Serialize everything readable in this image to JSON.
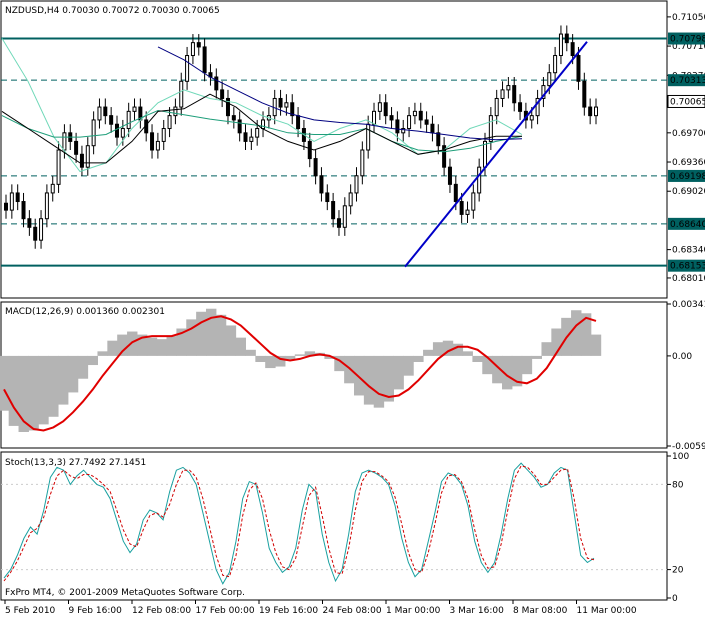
{
  "colors": {
    "background": "#ffffff",
    "frame": "#000000",
    "grid": "#000000",
    "candle_up": "#000000",
    "candle_down": "#000000",
    "ma_fast": "#000000",
    "ma_mid": "#1e9e7a",
    "ma_slow": "#6fd8b8",
    "ma_long": "#000080",
    "trendline": "#0000c8",
    "hline": "#006060",
    "hline_dash": "#006060",
    "macd_hist": "#b4b4b4",
    "macd_signal": "#e00000",
    "stoch_main": "#19a0a0",
    "stoch_signal": "#d00000",
    "label_box_fill": "#006060",
    "label_box_text": "#ffffff",
    "label_box_fill_white": "#ffffff"
  },
  "chart_data": [
    {
      "type": "candlestick",
      "title": "NZDUSD,H4  0.70030 0.70072 0.70030 0.70065",
      "ylim": [
        0.678,
        0.712
      ],
      "y_ticks": [
        "0.71050",
        "0.70710",
        "0.70370",
        "0.69700",
        "0.69360",
        "0.69020",
        "0.68340",
        "0.68010"
      ],
      "y_tick_values": [
        0.7105,
        0.7071,
        0.7037,
        0.697,
        0.6936,
        0.6902,
        0.6834,
        0.6801
      ],
      "current_price_label": "0.70065",
      "current_price": 0.70065,
      "horizontal_lines": [
        {
          "label": "0.70798",
          "value": 0.70798,
          "style": "solid"
        },
        {
          "label": "0.70313",
          "value": 0.70313,
          "style": "dashed"
        },
        {
          "label": "0.69198",
          "value": 0.69198,
          "style": "dashed"
        },
        {
          "label": "0.68640",
          "value": 0.6864,
          "style": "dashed"
        },
        {
          "label": "0.68153",
          "value": 0.68153,
          "style": "solid"
        }
      ],
      "trendline": {
        "from": {
          "bar": 155,
          "price": 0.6814
        },
        "to": {
          "bar": 225,
          "price": 0.7076
        }
      },
      "series": [
        {
          "kind": "ma",
          "points": [
            [
              0,
              0.708
            ],
            [
              10,
              0.703
            ],
            [
              20,
              0.6965
            ],
            [
              30,
              0.6925
            ],
            [
              40,
              0.6935
            ],
            [
              50,
              0.6975
            ],
            [
              60,
              0.7005
            ],
            [
              70,
              0.702
            ],
            [
              80,
              0.701
            ],
            [
              90,
              0.7005
            ],
            [
              100,
              0.699
            ],
            [
              110,
              0.698
            ],
            [
              120,
              0.696
            ],
            [
              130,
              0.6975
            ],
            [
              140,
              0.6985
            ],
            [
              150,
              0.697
            ],
            [
              160,
              0.6945
            ],
            [
              170,
              0.695
            ],
            [
              180,
              0.6975
            ],
            [
              190,
              0.6985
            ],
            [
              200,
              0.6968
            ]
          ],
          "color_key": "ma_slow"
        },
        {
          "kind": "ma",
          "points": [
            [
              0,
              0.699
            ],
            [
              10,
              0.6975
            ],
            [
              20,
              0.6965
            ],
            [
              30,
              0.6965
            ],
            [
              40,
              0.6968
            ],
            [
              50,
              0.6983
            ],
            [
              60,
              0.6996
            ],
            [
              70,
              0.6991
            ],
            [
              80,
              0.6986
            ],
            [
              90,
              0.6982
            ],
            [
              100,
              0.6978
            ],
            [
              110,
              0.697
            ],
            [
              120,
              0.6968
            ],
            [
              130,
              0.6968
            ],
            [
              140,
              0.6975
            ],
            [
              150,
              0.696
            ],
            [
              160,
              0.695
            ],
            [
              170,
              0.6948
            ],
            [
              180,
              0.6952
            ],
            [
              190,
              0.696
            ],
            [
              200,
              0.6966
            ]
          ],
          "color_key": "ma_mid"
        },
        {
          "kind": "ma",
          "points": [
            [
              0,
              0.6995
            ],
            [
              10,
              0.6975
            ],
            [
              20,
              0.6955
            ],
            [
              30,
              0.6935
            ],
            [
              40,
              0.6935
            ],
            [
              50,
              0.696
            ],
            [
              60,
              0.6995
            ],
            [
              70,
              0.6998
            ],
            [
              80,
              0.7015
            ],
            [
              90,
              0.7
            ],
            [
              100,
              0.6975
            ],
            [
              110,
              0.696
            ],
            [
              120,
              0.695
            ],
            [
              130,
              0.696
            ],
            [
              140,
              0.6975
            ],
            [
              150,
              0.696
            ],
            [
              160,
              0.6945
            ],
            [
              170,
              0.695
            ],
            [
              180,
              0.696
            ],
            [
              190,
              0.6966
            ],
            [
              200,
              0.6966
            ]
          ],
          "color_key": "ma_fast"
        },
        {
          "kind": "ma",
          "points": [
            [
              60,
              0.707
            ],
            [
              70,
              0.7055
            ],
            [
              80,
              0.7035
            ],
            [
              90,
              0.702
            ],
            [
              100,
              0.7005
            ],
            [
              110,
              0.6993
            ],
            [
              120,
              0.6985
            ],
            [
              130,
              0.6982
            ],
            [
              140,
              0.698
            ],
            [
              150,
              0.6975
            ],
            [
              160,
              0.6972
            ],
            [
              170,
              0.6968
            ],
            [
              180,
              0.6964
            ],
            [
              190,
              0.6962
            ],
            [
              200,
              0.6963
            ]
          ],
          "color_key": "ma_long"
        }
      ],
      "candles_note": "",
      "ohlc_closes": [
        0.688,
        0.69,
        0.689,
        0.687,
        0.686,
        0.6845,
        0.687,
        0.69,
        0.691,
        0.695,
        0.697,
        0.696,
        0.6945,
        0.693,
        0.6955,
        0.6985,
        0.7,
        0.699,
        0.698,
        0.6965,
        0.6975,
        0.6995,
        0.7,
        0.6985,
        0.697,
        0.695,
        0.696,
        0.6975,
        0.699,
        0.7,
        0.703,
        0.706,
        0.7075,
        0.707,
        0.704,
        0.7035,
        0.702,
        0.701,
        0.699,
        0.6985,
        0.697,
        0.696,
        0.6965,
        0.6975,
        0.6985,
        0.699,
        0.701,
        0.7,
        0.7005,
        0.699,
        0.6975,
        0.696,
        0.694,
        0.692,
        0.69,
        0.689,
        0.687,
        0.686,
        0.6885,
        0.69,
        0.692,
        0.695,
        0.698,
        0.6995,
        0.7005,
        0.699,
        0.6985,
        0.697,
        0.6975,
        0.699,
        0.6995,
        0.6985,
        0.698,
        0.697,
        0.6955,
        0.693,
        0.691,
        0.689,
        0.6875,
        0.688,
        0.69,
        0.693,
        0.696,
        0.699,
        0.701,
        0.702,
        0.7025,
        0.7005,
        0.6995,
        0.6985,
        0.699,
        0.701,
        0.7025,
        0.704,
        0.706,
        0.7085,
        0.7075,
        0.706,
        0.703,
        0.7,
        0.699,
        0.7
      ]
    },
    {
      "type": "histogram+line",
      "title": "MACD(12,26,9) 0.001360 0.002301",
      "ylim": [
        -0.00592,
        0.00341
      ],
      "y_ticks": [
        "0.00341",
        "0.00",
        "-0.00592"
      ],
      "y_tick_values": [
        0.00341,
        0.0,
        -0.00592
      ],
      "histogram": [
        -0.0036,
        -0.0046,
        -0.005,
        -0.0049,
        -0.0045,
        -0.004,
        -0.0032,
        -0.0024,
        -0.0015,
        -0.0006,
        0.0003,
        0.001,
        0.0014,
        0.0016,
        0.0014,
        0.0012,
        0.0011,
        0.0013,
        0.0018,
        0.0024,
        0.0029,
        0.0031,
        0.0027,
        0.002,
        0.0012,
        0.0004,
        -0.0004,
        -0.0008,
        -0.0007,
        -0.0003,
        0.0001,
        0.0003,
        0.0002,
        -0.0002,
        -0.001,
        -0.0018,
        -0.0026,
        -0.0032,
        -0.0034,
        -0.003,
        -0.0022,
        -0.0013,
        -0.0004,
        0.0004,
        0.0009,
        0.001,
        0.0008,
        0.0003,
        -0.0004,
        -0.0012,
        -0.0018,
        -0.0022,
        -0.002,
        -0.0012,
        -0.0002,
        0.0009,
        0.0018,
        0.0025,
        0.003,
        0.0028,
        0.0014
      ],
      "signal": [
        -0.0022,
        -0.0034,
        -0.0043,
        -0.0048,
        -0.0049,
        -0.0047,
        -0.0043,
        -0.0037,
        -0.003,
        -0.0022,
        -0.0013,
        -0.0005,
        0.0003,
        0.0009,
        0.0012,
        0.0013,
        0.0013,
        0.0013,
        0.0015,
        0.0018,
        0.0022,
        0.0025,
        0.0026,
        0.0024,
        0.002,
        0.0014,
        0.0008,
        0.0002,
        -0.0002,
        -0.0003,
        -0.0002,
        0.0,
        0.0001,
        0.0,
        -0.0003,
        -0.0008,
        -0.0014,
        -0.002,
        -0.0025,
        -0.0027,
        -0.0026,
        -0.0022,
        -0.0016,
        -0.0009,
        -0.0002,
        0.0003,
        0.0006,
        0.0006,
        0.0004,
        -0.0001,
        -0.0007,
        -0.0013,
        -0.0017,
        -0.0018,
        -0.0015,
        -0.0008,
        0.0002,
        0.0012,
        0.002,
        0.0025,
        0.0023
      ]
    },
    {
      "type": "line",
      "title": "Stoch(13,3,3) 27.7492 27.1451",
      "ylim": [
        0,
        100
      ],
      "y_ticks": [
        "100",
        "80",
        "20",
        "0"
      ],
      "y_tick_values": [
        100,
        80,
        20,
        0
      ],
      "series": [
        {
          "color_key": "stoch_main",
          "values": [
            14,
            20,
            30,
            42,
            50,
            45,
            62,
            85,
            92,
            90,
            80,
            86,
            90,
            85,
            80,
            78,
            70,
            55,
            40,
            32,
            38,
            55,
            62,
            60,
            55,
            75,
            90,
            92,
            88,
            80,
            60,
            40,
            20,
            10,
            18,
            40,
            70,
            82,
            80,
            60,
            35,
            25,
            18,
            22,
            35,
            62,
            80,
            75,
            45,
            25,
            12,
            20,
            45,
            75,
            88,
            90,
            88,
            85,
            80,
            65,
            42,
            25,
            15,
            20,
            40,
            60,
            82,
            88,
            86,
            80,
            65,
            40,
            25,
            18,
            25,
            45,
            70,
            90,
            95,
            90,
            85,
            78,
            80,
            88,
            92,
            90,
            60,
            30,
            25,
            28
          ]
        },
        {
          "color_key": "stoch_signal",
          "values": [
            12,
            18,
            26,
            36,
            46,
            49,
            57,
            73,
            86,
            90,
            86,
            84,
            87,
            87,
            84,
            80,
            75,
            62,
            48,
            38,
            36,
            48,
            58,
            60,
            57,
            66,
            80,
            90,
            90,
            85,
            70,
            50,
            30,
            16,
            15,
            30,
            58,
            76,
            81,
            70,
            48,
            32,
            22,
            20,
            28,
            50,
            72,
            78,
            58,
            35,
            18,
            17,
            35,
            62,
            82,
            89,
            89,
            86,
            82,
            71,
            52,
            32,
            20,
            18,
            32,
            52,
            74,
            86,
            87,
            82,
            70,
            48,
            30,
            21,
            22,
            38,
            62,
            84,
            93,
            92,
            87,
            80,
            80,
            85,
            90,
            91,
            70,
            42,
            28,
            27
          ]
        }
      ]
    }
  ],
  "x_axis": {
    "labels": [
      "5 Feb 2010",
      "9 Feb 16:00",
      "12 Feb 08:00",
      "17 Feb 00:00",
      "19 Feb 16:00",
      "24 Feb 08:00",
      "1 Mar 00:00",
      "3 Mar 16:00",
      "8 Mar 08:00",
      "11 Mar 00:00"
    ]
  },
  "footer": {
    "copyright": "FxPro MT4, © 2001-2009 MetaQuotes Software Corp."
  }
}
